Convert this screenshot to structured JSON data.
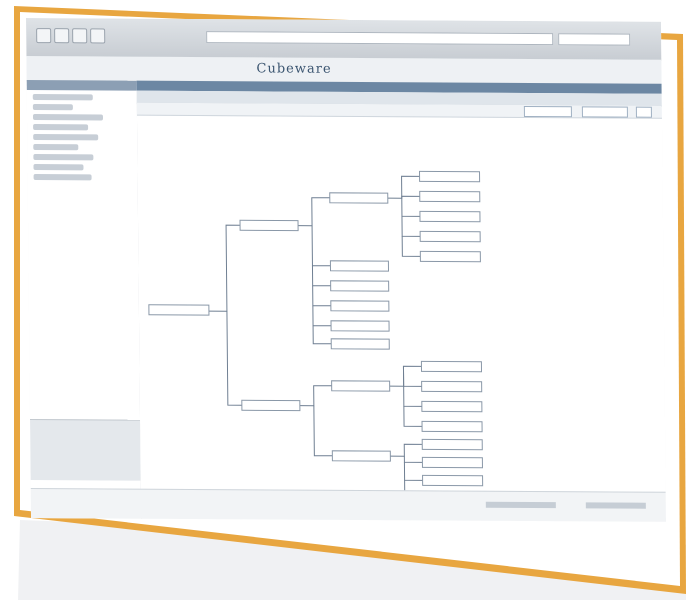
{
  "app": {
    "brand": "Cubeware"
  },
  "colors": {
    "frame": "#e8a640",
    "header": "#6c87a3",
    "node_fill": "#ffffff",
    "connector": "#6f7f92"
  }
}
